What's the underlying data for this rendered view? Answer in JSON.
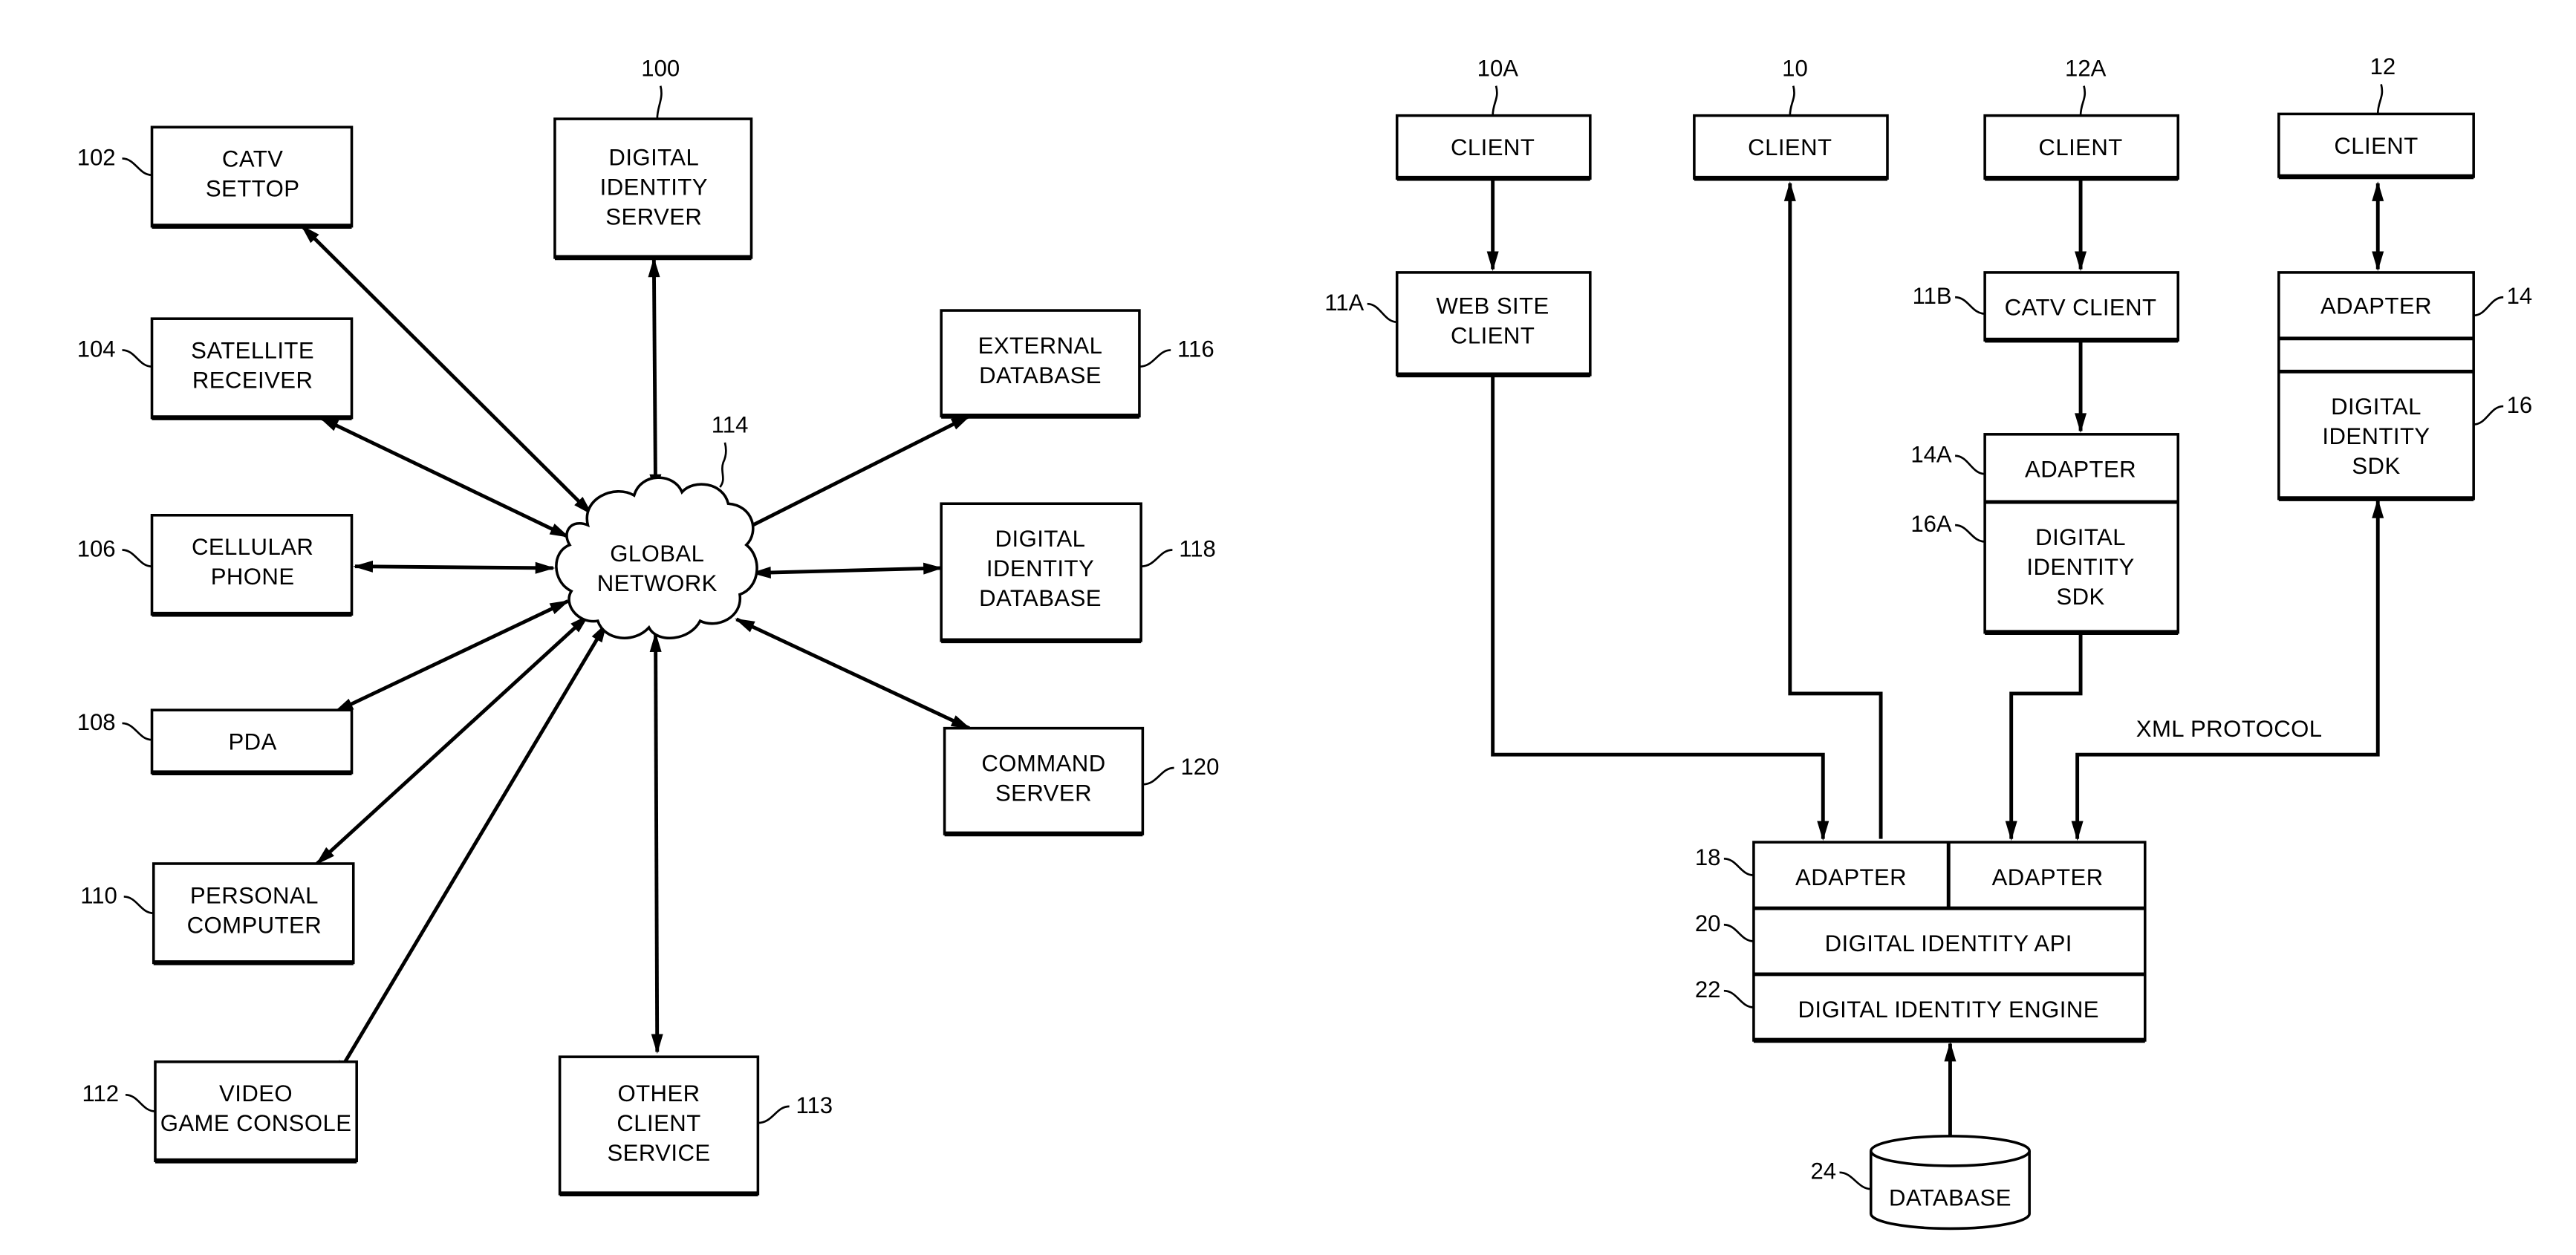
{
  "figure_left": {
    "hub": {
      "ref": "114",
      "label": [
        "GLOBAL",
        "NETWORK"
      ]
    },
    "nodes": [
      {
        "id": "digital-identity-server",
        "ref": "100",
        "label": [
          "DIGITAL",
          "IDENTITY",
          "SERVER"
        ]
      },
      {
        "id": "catv-settop",
        "ref": "102",
        "label": [
          "CATV",
          "SETTOP"
        ]
      },
      {
        "id": "satellite-receiver",
        "ref": "104",
        "label": [
          "SATELLITE",
          "RECEIVER"
        ]
      },
      {
        "id": "cellular-phone",
        "ref": "106",
        "label": [
          "CELLULAR",
          "PHONE"
        ]
      },
      {
        "id": "pda",
        "ref": "108",
        "label": [
          "PDA"
        ]
      },
      {
        "id": "personal-computer",
        "ref": "110",
        "label": [
          "PERSONAL",
          "COMPUTER"
        ]
      },
      {
        "id": "video-game-console",
        "ref": "112",
        "label": [
          "VIDEO",
          "GAME CONSOLE"
        ]
      },
      {
        "id": "other-client-service",
        "ref": "113",
        "label": [
          "OTHER",
          "CLIENT",
          "SERVICE"
        ]
      },
      {
        "id": "external-database",
        "ref": "116",
        "label": [
          "EXTERNAL",
          "DATABASE"
        ]
      },
      {
        "id": "digital-identity-database",
        "ref": "118",
        "label": [
          "DIGITAL",
          "IDENTITY",
          "DATABASE"
        ]
      },
      {
        "id": "command-server",
        "ref": "120",
        "label": [
          "COMMAND",
          "SERVER"
        ]
      }
    ]
  },
  "figure_right": {
    "clients": [
      {
        "ref": "10A",
        "label": "CLIENT"
      },
      {
        "ref": "10",
        "label": "CLIENT"
      },
      {
        "ref": "12A",
        "label": "CLIENT"
      },
      {
        "ref": "12",
        "label": "CLIENT"
      }
    ],
    "web_site_client": {
      "ref": "11A",
      "label": [
        "WEB SITE",
        "CLIENT"
      ]
    },
    "catv_client": {
      "ref": "11B",
      "label": "CATV CLIENT"
    },
    "adapter_a": {
      "ref": "14A",
      "label": "ADAPTER"
    },
    "sdk_a": {
      "ref": "16A",
      "label": [
        "DIGITAL",
        "IDENTITY",
        "SDK"
      ]
    },
    "adapter": {
      "ref": "14",
      "label": "ADAPTER"
    },
    "sdk": {
      "ref": "16",
      "label": [
        "DIGITAL",
        "IDENTITY",
        "SDK"
      ]
    },
    "xml_protocol": "XML PROTOCOL",
    "server_stack": {
      "adapter_ref": "18",
      "adapters": [
        "ADAPTER",
        "ADAPTER"
      ],
      "api_ref": "20",
      "api": "DIGITAL IDENTITY API",
      "engine_ref": "22",
      "engine": "DIGITAL IDENTITY ENGINE"
    },
    "database": {
      "ref": "24",
      "label": "DATABASE"
    }
  }
}
